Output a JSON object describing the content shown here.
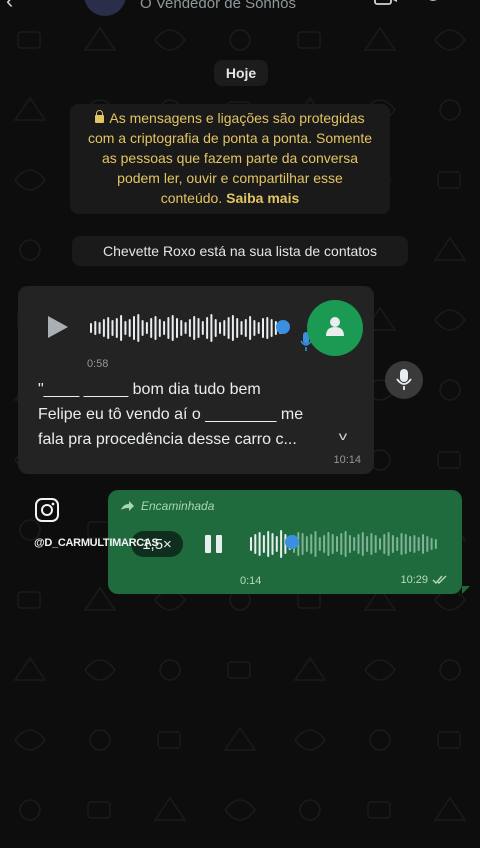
{
  "header": {
    "contact_name": "O Vendedor de Sonhos"
  },
  "date_chip": "Hoje",
  "encryption_notice": {
    "lines": [
      "As mensagens e ligações são protegidas",
      "com a criptografia de ponta a ponta. Somente",
      "as pessoas que fazem parte da conversa",
      "podem ler, ouvir e compartilhar esse"
    ],
    "last_line_text": "conteúdo.",
    "learn_more": "Saiba mais"
  },
  "contact_notice": "Chevette Roxo está na sua lista de contatos",
  "incoming_voice": {
    "duration": "0:58",
    "transcript_lines": [
      "\"____ _____ bom dia tudo bem",
      "Felipe eu tô vendo aí o ________ me",
      "fala pra procedência desse carro c..."
    ],
    "time": "10:14"
  },
  "outgoing_voice": {
    "forwarded_label": "Encaminhada",
    "speed": "1,5×",
    "duration": "0:14",
    "time": "10:29",
    "progress": 0.22
  },
  "watermark": "@D_CARMULTIMARCAS",
  "colors": {
    "background": "#0d0d0d",
    "incoming_bubble": "#232323",
    "outgoing_bubble": "#1f6b3e",
    "accent_green": "#1a9a52",
    "encryption_text": "#e3c463",
    "progress_dot": "#3b8fe0"
  }
}
